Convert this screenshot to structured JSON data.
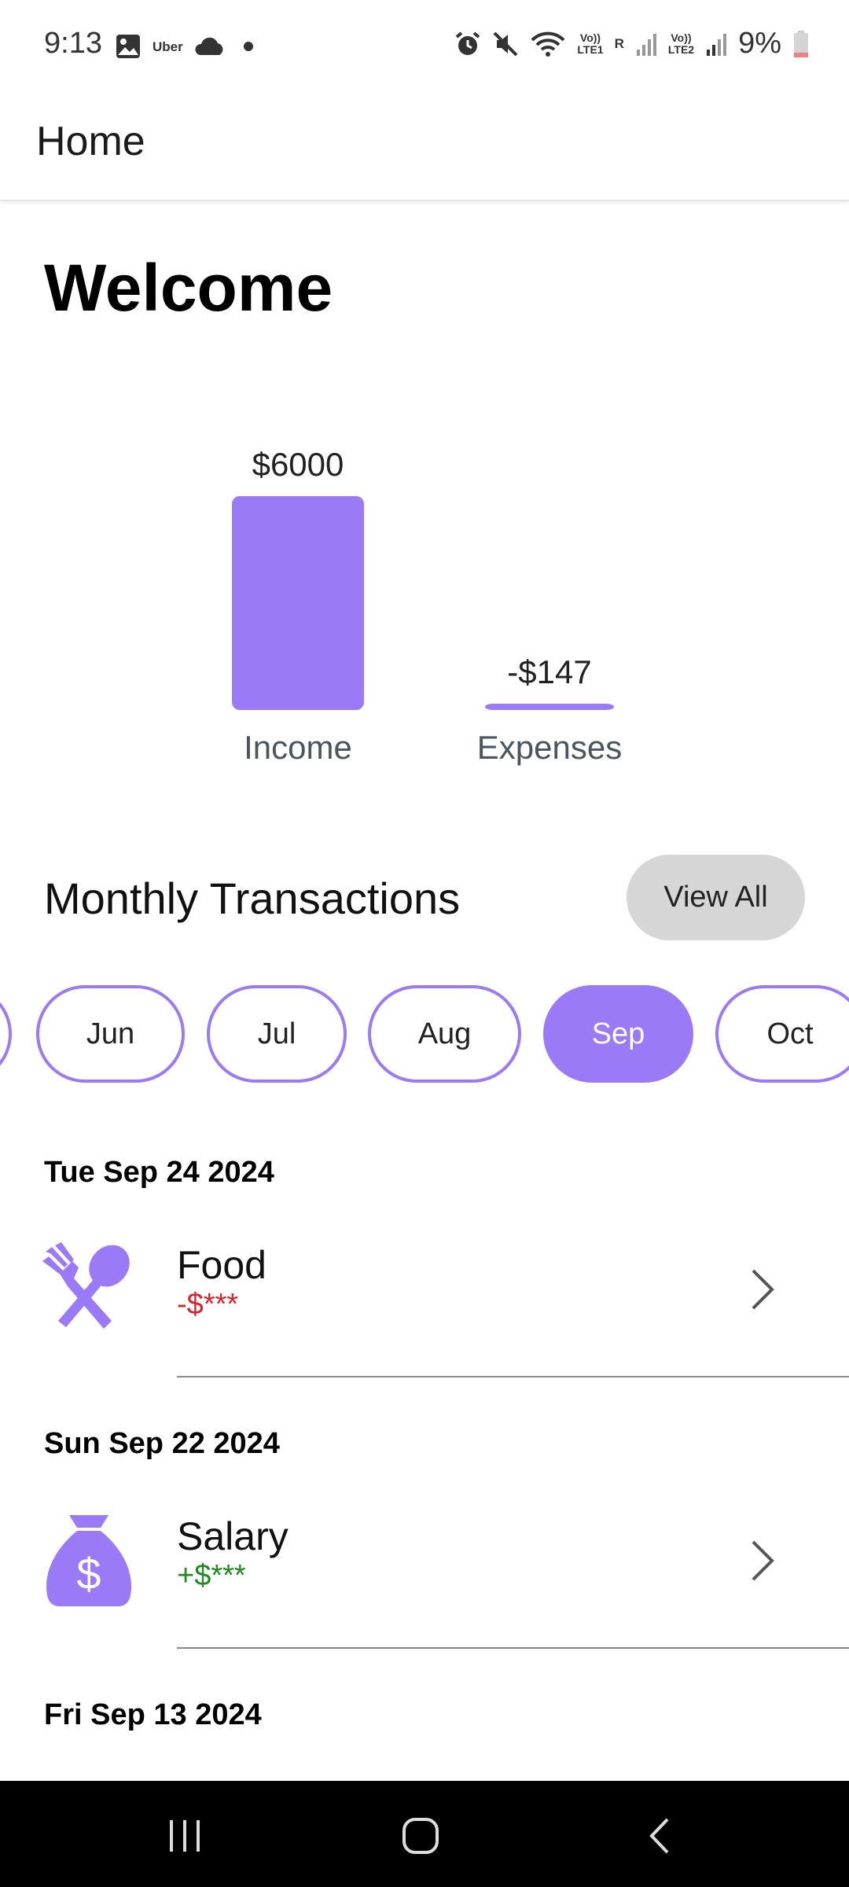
{
  "status_bar": {
    "time": "9:13",
    "uber_label": "Uber",
    "volte1": "Vo))",
    "lte1": "LTE1",
    "roaming": "R",
    "volte2": "Vo))",
    "lte2": "LTE2",
    "battery": "9%",
    "icons": [
      "gallery-icon",
      "cloud-icon",
      "dot-icon",
      "alarm-icon",
      "mute-icon",
      "wifi-icon",
      "signal-icon",
      "battery-icon"
    ]
  },
  "app_bar": {
    "title": "Home"
  },
  "welcome": "Welcome",
  "chart_data": {
    "type": "bar",
    "categories": [
      "Income",
      "Expenses"
    ],
    "values": [
      6000,
      147
    ],
    "data_labels": [
      "$6000",
      "-$147"
    ],
    "title": "",
    "xlabel": "",
    "ylabel": "",
    "ylim": [
      0,
      6000
    ],
    "grid": false,
    "color": "#9a7af7"
  },
  "monthly": {
    "title": "Monthly Transactions",
    "view_all": "View All",
    "months": [
      "Jun",
      "Jul",
      "Aug",
      "Sep",
      "Oct"
    ],
    "selected": "Sep"
  },
  "transactions": [
    {
      "date": "Tue Sep 24 2024",
      "name": "Food",
      "amount": "-$***",
      "amount_color": "#d8232a",
      "icon": "fork-spoon-icon"
    },
    {
      "date": "Sun Sep 22 2024",
      "name": "Salary",
      "amount": "+$***",
      "amount_color": "#1f8a1f",
      "icon": "money-bag-icon"
    },
    {
      "date": "Fri Sep 13 2024"
    }
  ],
  "colors": {
    "accent": "#9a7af7",
    "view_all_bg": "#d6d6d6",
    "nav_bg": "#000000"
  }
}
